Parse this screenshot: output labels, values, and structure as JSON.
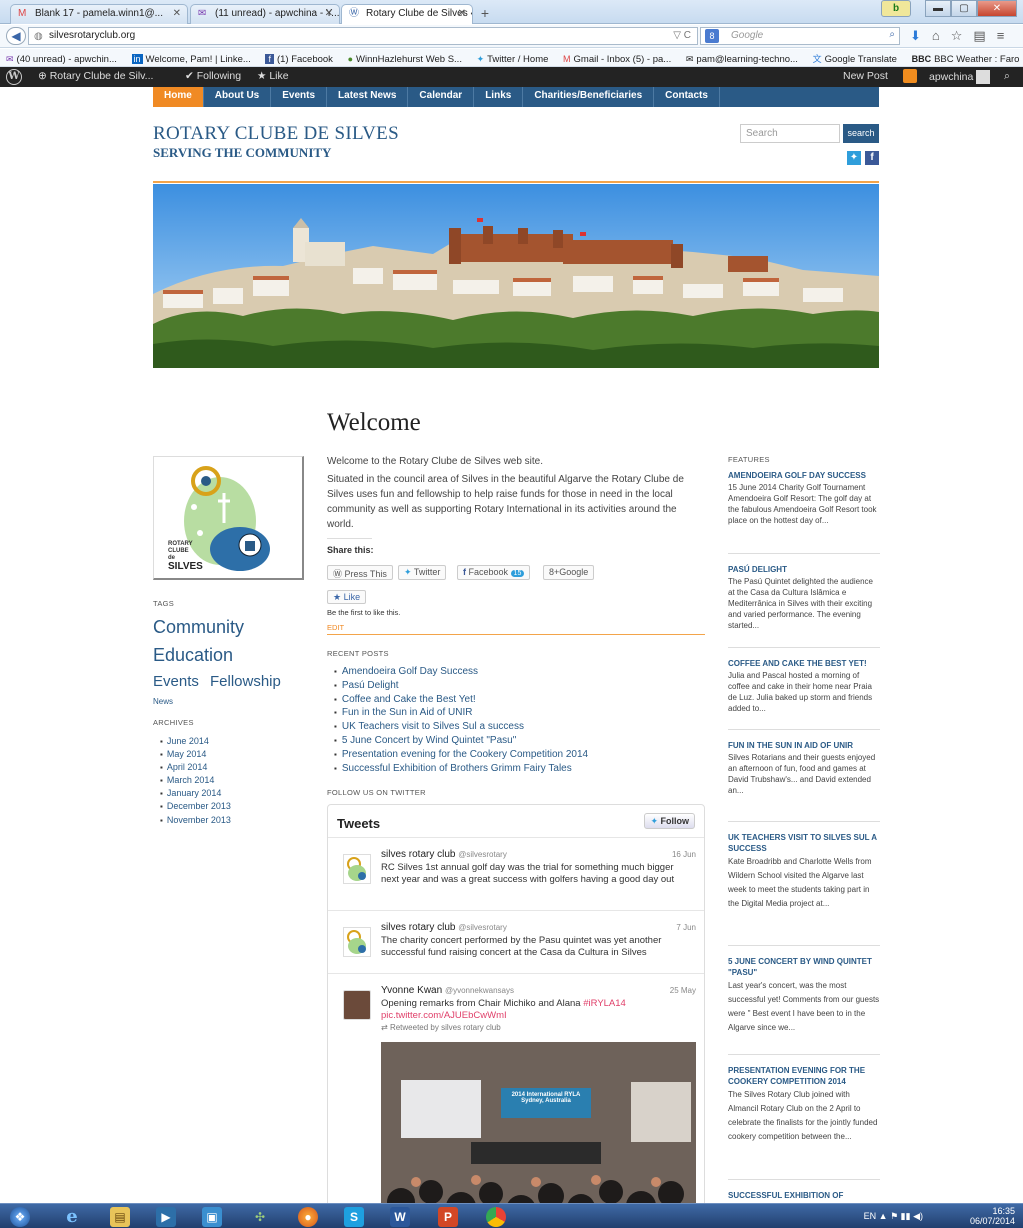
{
  "browser": {
    "tabs": [
      {
        "label": "Blank 17 - pamela.winn1@...",
        "icon": "gmail-icon"
      },
      {
        "label": "(11 unread) - apwchina - Y...",
        "icon": "yahoo-mail-icon"
      },
      {
        "label": "Rotary Clube de Silves « Se...",
        "icon": "wordpress-icon"
      }
    ],
    "url": "silvesrotaryclub.org",
    "search_placeholder": "Google",
    "bookmarks": [
      "(40 unread) - apwchin...",
      "Welcome, Pam! | Linke...",
      "(1) Facebook",
      "WinnHazlehurst Web S...",
      "Twitter / Home",
      "Gmail - Inbox (5) - pa...",
      "pam@learning-techno...",
      "Google Translate",
      "BBC Weather : Faro"
    ]
  },
  "wpbar": {
    "site": "Rotary Clube de Silv...",
    "following": "Following",
    "like": "Like",
    "new_post": "New Post",
    "user": "apwchina"
  },
  "site": {
    "menu": [
      "Home",
      "About Us",
      "Events",
      "Latest News",
      "Calendar",
      "Links",
      "Charities/Beneficiaries",
      "Contacts"
    ],
    "title": "ROTARY CLUBE DE SILVES",
    "subtitle": "SERVING THE COMMUNITY",
    "search_placeholder": "Search",
    "search_button": "search"
  },
  "sidebar": {
    "logo_text": [
      "ROTARY",
      "CLUBE",
      "de",
      "SILVES"
    ],
    "tags_label": "TAGS",
    "tags": {
      "community": "Community",
      "education": "Education",
      "events": "Events",
      "fellowship": "Fellowship",
      "news": "News"
    },
    "archives_label": "ARCHIVES",
    "archives": [
      "June 2014",
      "May 2014",
      "April 2014",
      "March 2014",
      "January 2014",
      "December 2013",
      "November 2013"
    ]
  },
  "main": {
    "heading": "Welcome",
    "intro": "Welcome to the Rotary Clube de Silves web site.",
    "body": "Situated in the council area of Silves in the beautiful  Algarve the Rotary Clube de Silves uses fun and fellowship to help raise funds for those in need in the local community as well as supporting Rotary International in its activities around the world.",
    "share_label": "Share this:",
    "share": {
      "press": "Press This",
      "twitter": "Twitter",
      "facebook": "Facebook",
      "facebook_count": "15",
      "google": "Google"
    },
    "like_button": "Like",
    "like_note": "Be the first to like this.",
    "edit": "EDIT",
    "recent_label": "RECENT POSTS",
    "recent": [
      "Amendoeira Golf Day Success",
      "Pasú Delight",
      "Coffee and Cake the Best Yet!",
      "Fun in the Sun in Aid of UNIR",
      "UK Teachers visit to Silves Sul a success",
      "5 June Concert by Wind Quintet \"Pasu\"",
      "Presentation evening for the Cookery Competition 2014",
      "Successful Exhibition of Brothers Grimm Fairy Tales"
    ],
    "follow_label": "FOLLOW US ON TWITTER",
    "tweets_title": "Tweets",
    "follow_button": "Follow",
    "tweets": [
      {
        "name": "silves rotary club",
        "handle": "@silvesrotary",
        "date": "16 Jun",
        "text": "RC Silves 1st annual golf day was the trial for something much bigger next year and was a great success with golfers having a good day out"
      },
      {
        "name": "silves rotary club",
        "handle": "@silvesrotary",
        "date": "7 Jun",
        "text": "The charity concert performed by the Pasu quintet was yet another successful fund raising concert at the Casa da Cultura in Silves"
      },
      {
        "name": "Yvonne Kwan",
        "handle": "@yvonnekwansays",
        "date": "25 May",
        "text": "Opening remarks from Chair Michiko and Alana",
        "hashtag": "#iRYLA14",
        "link": "pic.twitter.com/AJUEbCwWmI",
        "retweet": "Retweeted by silves rotary club",
        "photo_caption": "2014 International RYLA Sydney, Australia"
      }
    ]
  },
  "features": {
    "label": "FEATURES",
    "items": [
      {
        "title": "AMENDOEIRA GOLF DAY SUCCESS",
        "text": "15 June 2014 Charity Golf Tournament Amendoeira Golf Resort: The golf day at the fabulous Amendoeira Golf Resort took place on the hottest day of..."
      },
      {
        "title": "PASÚ DELIGHT",
        "text": "The Pasú Quintet delighted the audience at the Casa da Cultura Islâmica e Mediterrânica in Silves with their exciting and varied performance. The evening started..."
      },
      {
        "title": "COFFEE AND CAKE THE BEST YET!",
        "text": "Julia and Pascal hosted a morning of coffee and cake in their home near Praia de Luz. Julia baked up storm and friends added to..."
      },
      {
        "title": "FUN IN THE SUN IN AID OF UNIR",
        "text": "Silves Rotarians and their guests enjoyed an afternoon of fun, food and games at David Trubshaw's... and David extended an..."
      },
      {
        "title": "UK TEACHERS VISIT TO SILVES SUL A SUCCESS",
        "text": "Kate Broadribb and Charlotte Wells from Wildern School visited the Algarve last week to meet the students taking part in the Digital Media project at..."
      },
      {
        "title": "5 JUNE CONCERT BY WIND QUINTET \"PASU\"",
        "text": "Last year's  concert, was the most successful yet!  Comments from our guests were \" Best event I have been to in the Algarve since we..."
      },
      {
        "title": "PRESENTATION EVENING FOR THE COOKERY COMPETITION 2014",
        "text": "The Silves Rotary Club joined with Almancil Rotary Club on the 2 April to celebrate the finalists for the jointly funded cookery competition between the..."
      },
      {
        "title": "SUCCESSFUL EXHIBITION OF",
        "text": ""
      }
    ]
  },
  "taskbar": {
    "language": "EN",
    "time": "16:35",
    "date": "06/07/2014"
  }
}
